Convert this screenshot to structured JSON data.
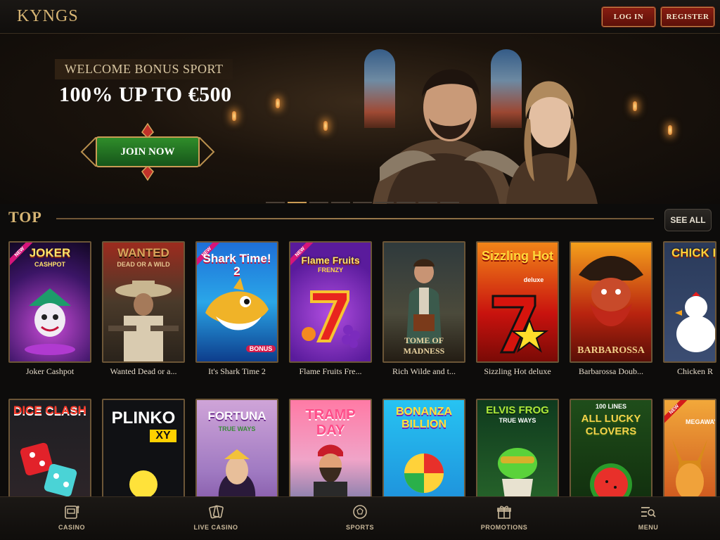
{
  "header": {
    "logo": "KYNGS",
    "login_label": "LOG IN",
    "register_label": "REGISTER"
  },
  "hero": {
    "subtitle": "WELCOME BONUS SPORT",
    "title": "100% UP TO €500",
    "cta_label": "JOIN NOW",
    "slide_count": 9,
    "active_slide": 2
  },
  "section": {
    "title": "TOP",
    "see_all_label": "SEE ALL"
  },
  "games_row1": [
    {
      "name": "Joker Cashpot",
      "art": "JOKER",
      "art_sub": "CASHPOT",
      "ribbon": "NEW"
    },
    {
      "name": "Wanted Dead or a...",
      "art": "WANTED",
      "art_sub": "DEAD OR A WILD"
    },
    {
      "name": "It's Shark Time 2",
      "art": "Shark Time! 2",
      "art_sub": "BONUS",
      "ribbon": "NEW"
    },
    {
      "name": "Flame Fruits Fre...",
      "art": "Flame Fruits",
      "art_sub": "FRENZY",
      "ribbon": "NEW"
    },
    {
      "name": "Rich Wilde and t...",
      "art": "",
      "art_sub": "TOME OF MADNESS"
    },
    {
      "name": "Sizzling Hot deluxe",
      "art": "Sizzling Hot",
      "art_sub": "deluxe"
    },
    {
      "name": "Barbarossa Doub...",
      "art": "",
      "art_sub": "BARBAROSSA"
    },
    {
      "name": "Chicken R",
      "art": "CHICK ROA",
      "art_sub": ""
    }
  ],
  "games_row2": [
    {
      "name": "",
      "art": "DICE CLASH",
      "art_sub": ""
    },
    {
      "name": "",
      "art": "PLINKO",
      "art_sub": "XY"
    },
    {
      "name": "",
      "art": "FORTUNA",
      "art_sub": "TRUE WAYS"
    },
    {
      "name": "",
      "art": "TRAMP DAY",
      "art_sub": ""
    },
    {
      "name": "",
      "art": "BONANZA BILLION",
      "art_sub": ""
    },
    {
      "name": "",
      "art": "ELVIS FROG",
      "art_sub": "TRUE WAYS"
    },
    {
      "name": "",
      "art": "ALL LUCKY CLOVERS",
      "art_sub": "100 LINES"
    },
    {
      "name": "",
      "art": "",
      "art_sub": "MEGAWAYS",
      "ribbon": "NEW"
    }
  ],
  "bottom_nav": [
    {
      "label": "CASINO",
      "icon": "slot-machine-icon"
    },
    {
      "label": "LIVE CASINO",
      "icon": "cards-icon"
    },
    {
      "label": "SPORTS",
      "icon": "soccer-ball-icon"
    },
    {
      "label": "PROMOTIONS",
      "icon": "gift-icon"
    },
    {
      "label": "MENU",
      "icon": "menu-search-icon"
    }
  ],
  "colors": {
    "accent_gold": "#d7b574",
    "button_red": "#8a1e12",
    "cta_green": "#2f8d2a",
    "background": "#0d0c0b"
  }
}
